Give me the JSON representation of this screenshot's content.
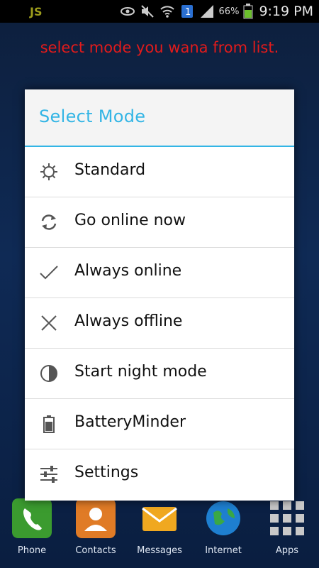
{
  "status_bar": {
    "battery_percent": "66%",
    "time": "9:19 PM",
    "icons": [
      "eye-icon",
      "mute-icon",
      "wifi-icon",
      "notification-badge-icon",
      "signal-icon",
      "battery-icon"
    ],
    "notification_badge": "1"
  },
  "banner_text": "select mode you wana from list.",
  "dialog": {
    "title": "Select Mode",
    "items": [
      {
        "label": "Standard",
        "icon": "gear-icon"
      },
      {
        "label": "Go online now",
        "icon": "sync-icon"
      },
      {
        "label": "Always online",
        "icon": "checkmark-icon"
      },
      {
        "label": "Always offline",
        "icon": "x-icon"
      },
      {
        "label": "Start night mode",
        "icon": "half-moon-icon"
      },
      {
        "label": "BatteryMinder",
        "icon": "battery-icon"
      },
      {
        "label": "Settings",
        "icon": "sliders-icon"
      }
    ]
  },
  "dock": {
    "items": [
      {
        "label": "Phone"
      },
      {
        "label": "Contacts"
      },
      {
        "label": "Messages"
      },
      {
        "label": "Internet"
      },
      {
        "label": "Apps"
      }
    ]
  },
  "colors": {
    "accent": "#33b5e5",
    "banner": "#e21b1b",
    "battery": "#6bbf2c"
  }
}
